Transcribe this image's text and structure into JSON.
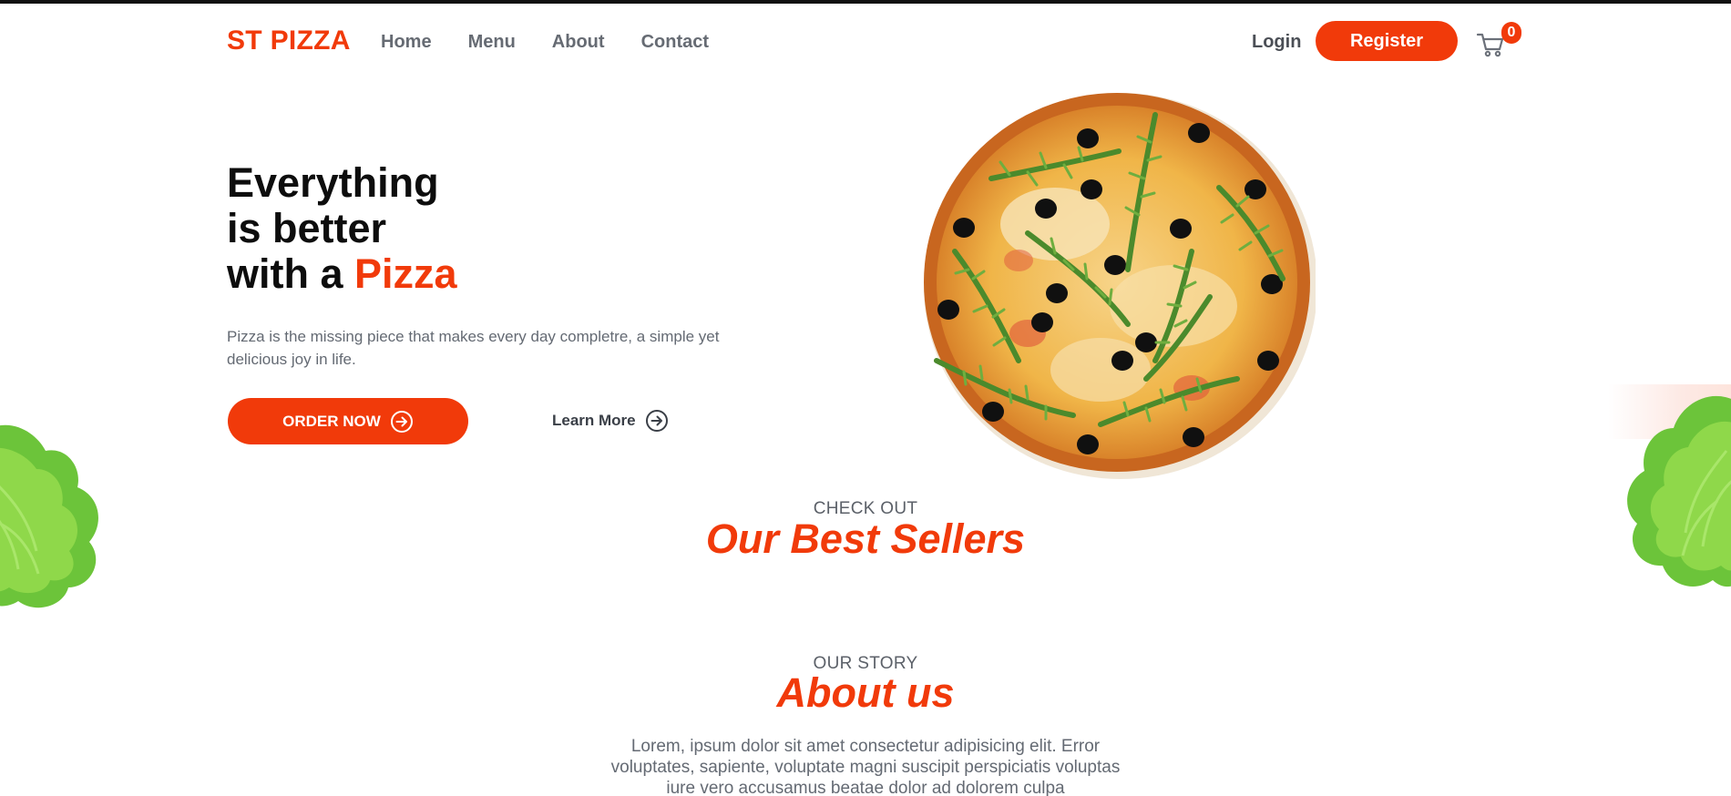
{
  "header": {
    "logo": "ST PIZZA",
    "nav": [
      {
        "label": "Home"
      },
      {
        "label": "Menu"
      },
      {
        "label": "About"
      },
      {
        "label": "Contact"
      }
    ],
    "login_label": "Login",
    "register_label": "Register",
    "cart_icon": "cart-icon",
    "cart_count": "0"
  },
  "hero": {
    "title_line1": "Everything",
    "title_line2": "is better",
    "title_line3_prefix": "with a ",
    "title_line3_accent": "Pizza",
    "description": "Pizza is the missing piece that makes every day completre, a simple yet delicious joy in life.",
    "order_label": "ORDER NOW",
    "learn_label": "Learn More",
    "arrow_icon": "arrow-right-circle-icon"
  },
  "best_sellers": {
    "eyebrow": "CHECK OUT",
    "title": "Our Best Sellers"
  },
  "about": {
    "eyebrow": "OUR STORY",
    "title": "About us",
    "text": "Lorem, ipsum dolor sit amet consectetur adipisicing elit. Error voluptates, sapiente, voluptate magni suscipit perspiciatis voluptas iure vero accusamus beatae dolor ad dolorem culpa"
  },
  "colors": {
    "accent": "#f13a0a",
    "nav_text": "#666b73",
    "body_text": "#646a73"
  }
}
